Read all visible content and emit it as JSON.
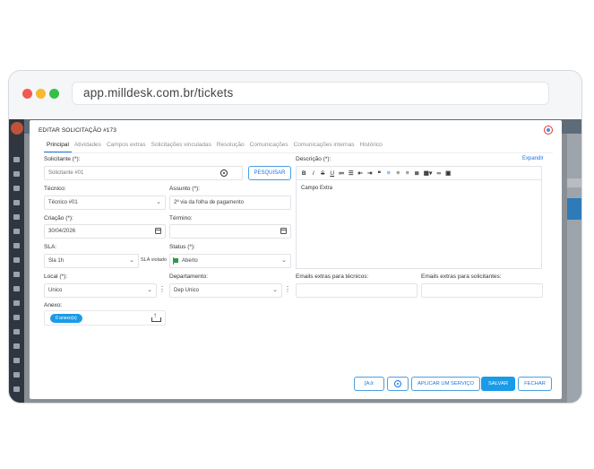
{
  "browser": {
    "url": "app.milldesk.com.br/tickets"
  },
  "modal": {
    "title": "EDITAR SOLICITAÇÃO #173",
    "tabs": [
      "Principal",
      "Atividades",
      "Campos extras",
      "Solicitações vinculadas",
      "Resolução",
      "Comunicações",
      "Comunicações internas",
      "Histórico"
    ],
    "active_tab": "Principal"
  },
  "form": {
    "solicitante": {
      "label": "Solicitante (*):",
      "value": "Solicitante #01",
      "search_button": "PESQUISAR"
    },
    "tecnico": {
      "label": "Técnico:",
      "value": "Técnico #01"
    },
    "assunto": {
      "label": "Assunto (*):",
      "value": "2ª via da folha de pagamento"
    },
    "criacao": {
      "label": "Criação (*):",
      "value": "30/04/2026"
    },
    "termino": {
      "label": "Término:",
      "value": ""
    },
    "sla": {
      "label": "SLA:",
      "value": "Sla 1h",
      "note": "SLA violado"
    },
    "status": {
      "label": "Status (*):",
      "value": "Aberto",
      "color": "#2e9a47"
    },
    "local": {
      "label": "Local (*):",
      "value": "Unico"
    },
    "departamento": {
      "label": "Departamento:",
      "value": "Dep Unico"
    },
    "emails_tecnicos": {
      "label": "Emails extras para técnicos:",
      "value": ""
    },
    "emails_solicitantes": {
      "label": "Emails extras para solicitantes:",
      "value": ""
    },
    "anexo": {
      "label": "Anexo:",
      "pill": "0 anexo(s)"
    },
    "descricao": {
      "label": "Descrição (*):",
      "expand": "Expandir",
      "content": "Campo Extra"
    }
  },
  "footer": {
    "spellcheck": "[A✰",
    "apply_service": "APLICAR UM SERVIÇO",
    "save": "SALVAR",
    "close": "FECHAR"
  },
  "colors": {
    "accent": "#1a9be8",
    "link": "#1a73e8",
    "sidebar": "#2f3640"
  }
}
